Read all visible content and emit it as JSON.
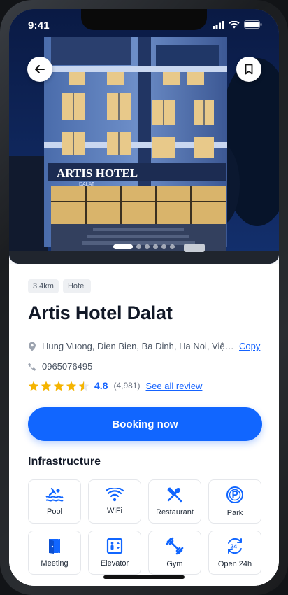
{
  "status": {
    "time": "9:41"
  },
  "hero": {
    "sign_line1": "ARTIS HOTEL",
    "sign_line2": "DALAT",
    "slides": 6,
    "active_slide": 1
  },
  "tags": [
    "3.4km",
    "Hotel"
  ],
  "hotel": {
    "name": "Artis Hotel Dalat",
    "address": "Hung Vuong, Dien Bien, Ba Dinh, Ha Noi, Việt Nam",
    "copy_label": "Copy",
    "phone": "0965076495",
    "rating": "4.8",
    "stars": 4.5,
    "review_count": "(4,981)",
    "see_all_label": "See all review"
  },
  "booking_label": "Booking now",
  "infrastructure": {
    "title": "Infrastructure",
    "items": [
      {
        "label": "Pool",
        "icon": "pool-icon"
      },
      {
        "label": "WiFi",
        "icon": "wifi-icon"
      },
      {
        "label": "Restaurant",
        "icon": "restaurant-icon"
      },
      {
        "label": "Park",
        "icon": "parking-icon"
      },
      {
        "label": "Meeting",
        "icon": "meeting-door-icon"
      },
      {
        "label": "Elevator",
        "icon": "elevator-icon"
      },
      {
        "label": "Gym",
        "icon": "dumbbell-icon"
      },
      {
        "label": "Open 24h",
        "icon": "open-24h-icon"
      }
    ]
  },
  "colors": {
    "accent": "#1166ff",
    "star": "#f5b400"
  }
}
